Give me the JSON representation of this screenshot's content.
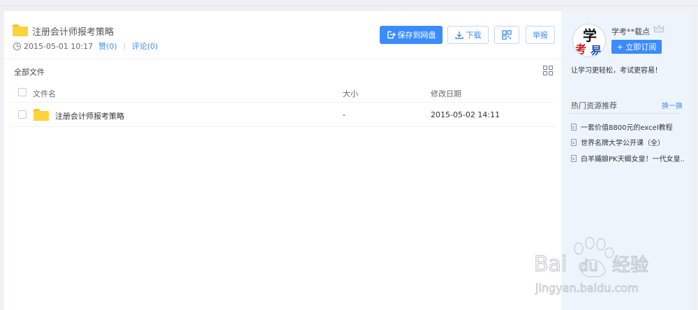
{
  "file": {
    "title": "注册会计师报考策略",
    "date": "2015-05-01 10:17",
    "likes": "赞(0)",
    "comments": "评论(0)"
  },
  "toolbar": {
    "save_label": "保存到网盘",
    "download_label": "下载",
    "report_label": "举报"
  },
  "listing": {
    "breadcrumb": "全部文件",
    "headers": {
      "name": "文件名",
      "size": "大小",
      "date": "修改日期"
    },
    "rows": [
      {
        "name": "注册会计师报考策略",
        "size": "-",
        "date": "2015-05-02 14:11"
      }
    ]
  },
  "sidebar": {
    "user": "学考**载点",
    "avatar_chars": [
      "学",
      "考",
      "易"
    ],
    "subscribe_label": "+ 立即订阅",
    "slogan": "让学习更轻松，考试更容易！",
    "hot_title": "热门资源推荐",
    "hot_more": "换一换",
    "hot_items": [
      "一套价值8800元的excel教程",
      "世界名牌大学公开课（全）",
      "白羊孀娘PK天蝎女皇！一代女皇..."
    ]
  },
  "watermark": {
    "brand": "Bai du 经验",
    "url": "jingyan.baidu.com"
  },
  "colors": {
    "accent": "#3b8cff",
    "folder": "#fcd33d",
    "sidebar_bg": "#eef4fc"
  },
  "icons": [
    "folder-icon",
    "clock-icon",
    "save-icon",
    "download-icon",
    "qrcode-icon",
    "grid-view-icon",
    "document-icon",
    "crown-icon"
  ]
}
